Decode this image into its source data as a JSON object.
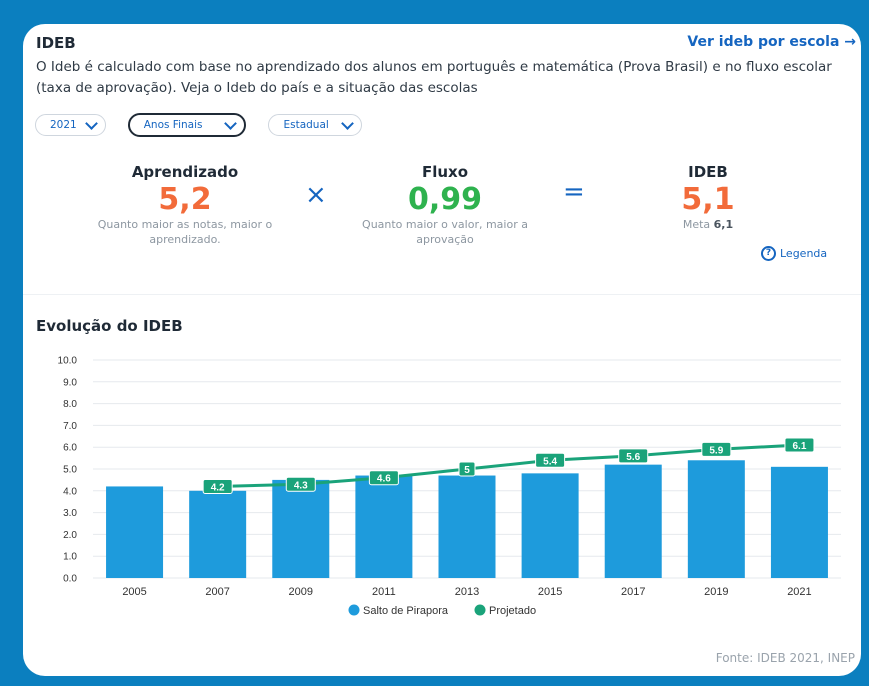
{
  "header": {
    "title": "IDEB",
    "link_label": "Ver ideb por escola →",
    "description": "O Ideb é calculado com base no aprendizado dos alunos em português e matemática (Prova Brasil) e no fluxo escolar (taxa de aprovação). Veja o Ideb do país e a situação das escolas"
  },
  "filters": {
    "year": "2021",
    "stage": "Anos Finais",
    "network": "Estadual"
  },
  "metrics": {
    "aprendizado": {
      "label": "Aprendizado",
      "value": "5,2",
      "note": "Quanto maior as notas, maior o aprendizado.",
      "color": "#f26b3a"
    },
    "fluxo": {
      "label": "Fluxo",
      "value": "0,99",
      "note": "Quanto maior o valor, maior a aprovação",
      "color": "#2eb24e"
    },
    "ideb": {
      "label": "IDEB",
      "value": "5,1",
      "meta_label": "Meta",
      "meta_value": "6,1",
      "color": "#f26b3a"
    },
    "times_symbol": "×",
    "equals_symbol": "=",
    "legend_link": "Legenda"
  },
  "evolution": {
    "title": "Evolução do IDEB"
  },
  "chart_data": {
    "type": "bar",
    "categories": [
      "2005",
      "2007",
      "2009",
      "2011",
      "2013",
      "2015",
      "2017",
      "2019",
      "2021"
    ],
    "series": [
      {
        "name": "Salto de Pirapora",
        "type": "bar",
        "color": "#1e9bdc",
        "values": [
          4.2,
          4.0,
          4.5,
          4.7,
          4.7,
          4.8,
          5.2,
          5.4,
          5.1
        ]
      },
      {
        "name": "Projetado",
        "type": "line",
        "color": "#1aa37a",
        "values": [
          null,
          4.2,
          4.3,
          4.6,
          5.0,
          5.4,
          5.6,
          5.9,
          6.1
        ],
        "labels": [
          null,
          "4.2",
          "4.3",
          "4.6",
          "5",
          "5.4",
          "5.6",
          "5.9",
          "6.1"
        ]
      }
    ],
    "ylim": [
      0,
      10
    ],
    "yticks": [
      "0.0",
      "1.0",
      "2.0",
      "3.0",
      "4.0",
      "5.0",
      "6.0",
      "7.0",
      "8.0",
      "9.0",
      "10.0"
    ],
    "grid": true,
    "legend_position": "bottom"
  },
  "footer": {
    "source": "Fonte: IDEB 2021, INEP"
  }
}
